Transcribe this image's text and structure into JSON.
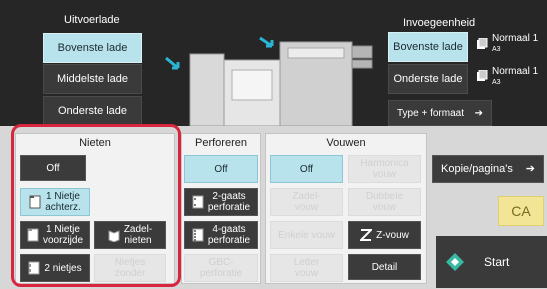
{
  "output_tray": {
    "title": "Uitvoerlade",
    "buttons": [
      "Bovenste lade",
      "Middelste lade",
      "Onderste lade"
    ],
    "selected": 0
  },
  "input_unit": {
    "title": "Invoegeenheid",
    "buttons": [
      "Bovenste lade",
      "Onderste lade"
    ],
    "selected": 0,
    "paper": [
      {
        "label": "Normaal 1",
        "size": "A3"
      },
      {
        "label": "Normaal 1",
        "size": "A3"
      }
    ],
    "type_format_label": "Type + formaat"
  },
  "stapling": {
    "title": "Nieten",
    "off": "Off",
    "one_back": "1 Nietje\nachterz.",
    "one_front": "1 Nietje\nvoorzijde",
    "two": "2 nietjes",
    "saddle": "Zadel-\nnieten",
    "disabled_stapler": "Nietjes\nzonder"
  },
  "punch": {
    "title": "Perforeren",
    "off": "Off",
    "two_hole": "2-gaats\nperforatie",
    "four_hole": "4-gaats\nperforatie",
    "gbc": "GBC-\nperforatie"
  },
  "fold": {
    "title": "Vouwen",
    "off": "Off",
    "harmonica": "Harmonica\nvouw",
    "zadel": "Zadel-\nvouw",
    "dubbele": "Dubbele\nvouw",
    "enkele": "Enkele vouw",
    "z_vouw": "Z-vouw",
    "letter": "Letter\nvouw",
    "detail": "Detail"
  },
  "right": {
    "copies_pages": "Kopie/pagina's",
    "ca": "CA",
    "start": "Start"
  },
  "colors": {
    "selected": "#b9e3ec",
    "highlight_border": "#d7263d",
    "ca_button": "#f3e596",
    "start_icon": "#39b9a3"
  }
}
